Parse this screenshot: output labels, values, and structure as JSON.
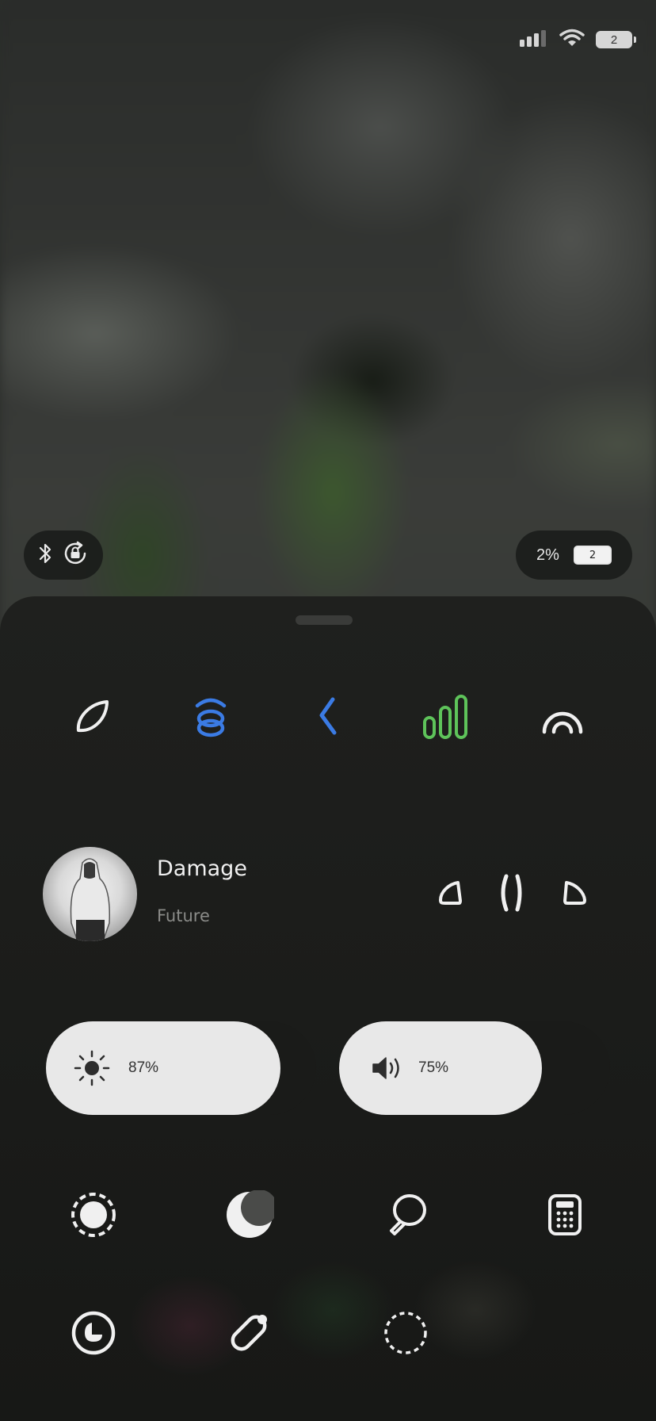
{
  "status_bar": {
    "battery_level": "2",
    "icons": [
      "cellular-signal-icon",
      "wifi-icon",
      "battery-icon"
    ]
  },
  "quick_pills": {
    "left_icons": [
      "bluetooth-icon",
      "rotation-lock-icon"
    ],
    "battery_percent": "2%",
    "battery_level": "2"
  },
  "toggles": [
    {
      "name": "data-saver",
      "icon": "leaf-icon",
      "color": "#f0f0f0"
    },
    {
      "name": "wifi",
      "icon": "wifi-icon",
      "color": "#3b7be4"
    },
    {
      "name": "bluetooth",
      "icon": "bluetooth-icon",
      "color": "#3b7be4"
    },
    {
      "name": "mobile-data",
      "icon": "signal-bars-icon",
      "color": "#5ec35a"
    },
    {
      "name": "hotspot",
      "icon": "hotspot-icon",
      "color": "#f0f0f0"
    }
  ],
  "media": {
    "title": "Damage",
    "artist": "Future",
    "controls": [
      "previous-icon",
      "pause-icon",
      "next-icon"
    ]
  },
  "sliders": {
    "brightness": {
      "icon": "sun-icon",
      "label": "87%",
      "value": 0.87
    },
    "volume": {
      "icon": "speaker-icon",
      "label": "75%",
      "value": 0.75
    }
  },
  "shortcuts_row1": [
    "focus-mode-icon",
    "night-mode-icon",
    "flashlight-icon",
    "calculator-icon"
  ],
  "shortcuts_row2": [
    "clock-icon",
    "battery-saver-icon",
    "screen-record-icon"
  ],
  "colors": {
    "accent_blue": "#3b7be4",
    "accent_green": "#5ec35a",
    "sheet_bg": "#1c1d1b",
    "slider_fill": "#e8e8e8"
  }
}
